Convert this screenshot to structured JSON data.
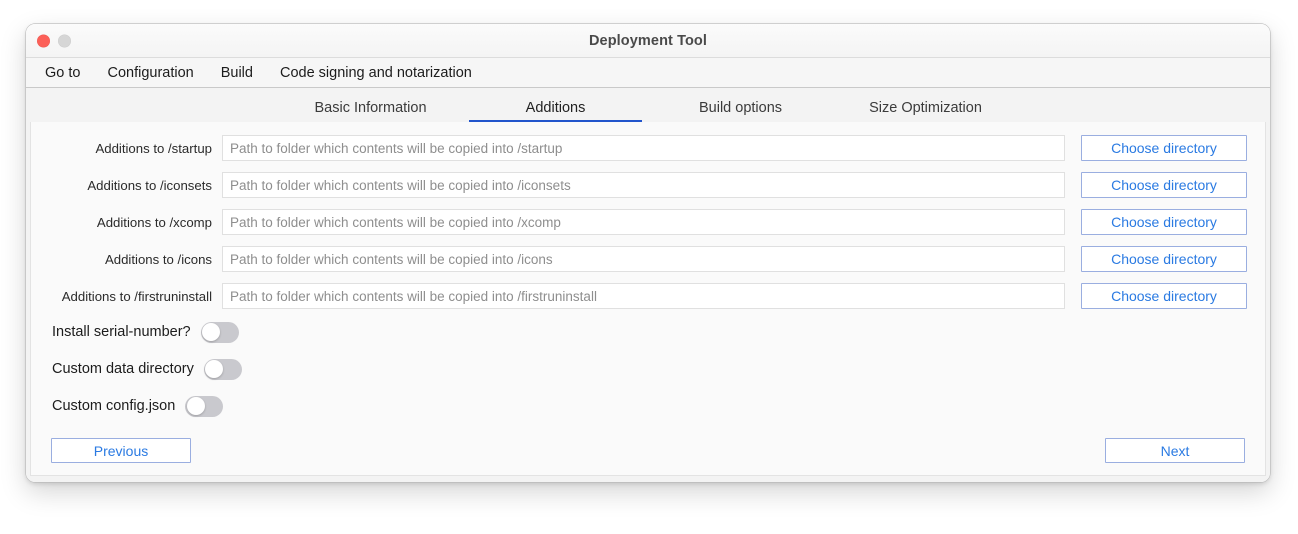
{
  "window": {
    "title": "Deployment Tool",
    "controls": [
      {
        "name": "close",
        "color": "#fc6058"
      },
      {
        "name": "minimize",
        "color": "#d6d6d6"
      }
    ]
  },
  "menubar": {
    "items": [
      {
        "label": "Go to"
      },
      {
        "label": "Configuration"
      },
      {
        "label": "Build"
      },
      {
        "label": "Code signing and notarization"
      }
    ]
  },
  "tabs": {
    "active_index": 1,
    "accent_color": "#2255cc",
    "items": [
      {
        "label": "Basic Information"
      },
      {
        "label": "Additions"
      },
      {
        "label": "Build options"
      },
      {
        "label": "Size Optimization"
      }
    ]
  },
  "form": {
    "button_label": "Choose directory",
    "rows": [
      {
        "label": "Additions to /startup",
        "value": "",
        "placeholder": "Path to folder which contents will be copied into /startup"
      },
      {
        "label": "Additions to /iconsets",
        "value": "",
        "placeholder": "Path to folder which contents will be copied into /iconsets"
      },
      {
        "label": "Additions to /xcomp",
        "value": "",
        "placeholder": "Path to folder which contents will be copied into /xcomp"
      },
      {
        "label": "Additions to /icons",
        "value": "",
        "placeholder": "Path to folder which contents will be copied into /icons"
      },
      {
        "label": "Additions to /firstruninstall",
        "value": "",
        "placeholder": "Path to folder which contents will be copied into /firstruninstall"
      }
    ],
    "toggles": [
      {
        "label": "Install serial-number?",
        "state": "off"
      },
      {
        "label": "Custom data directory",
        "state": "off"
      },
      {
        "label": "Custom config.json",
        "state": "off"
      }
    ]
  },
  "footer": {
    "previous_label": "Previous",
    "next_label": "Next",
    "button_text_color": "#2a7ae2",
    "button_border_color": "#9aaee0"
  }
}
